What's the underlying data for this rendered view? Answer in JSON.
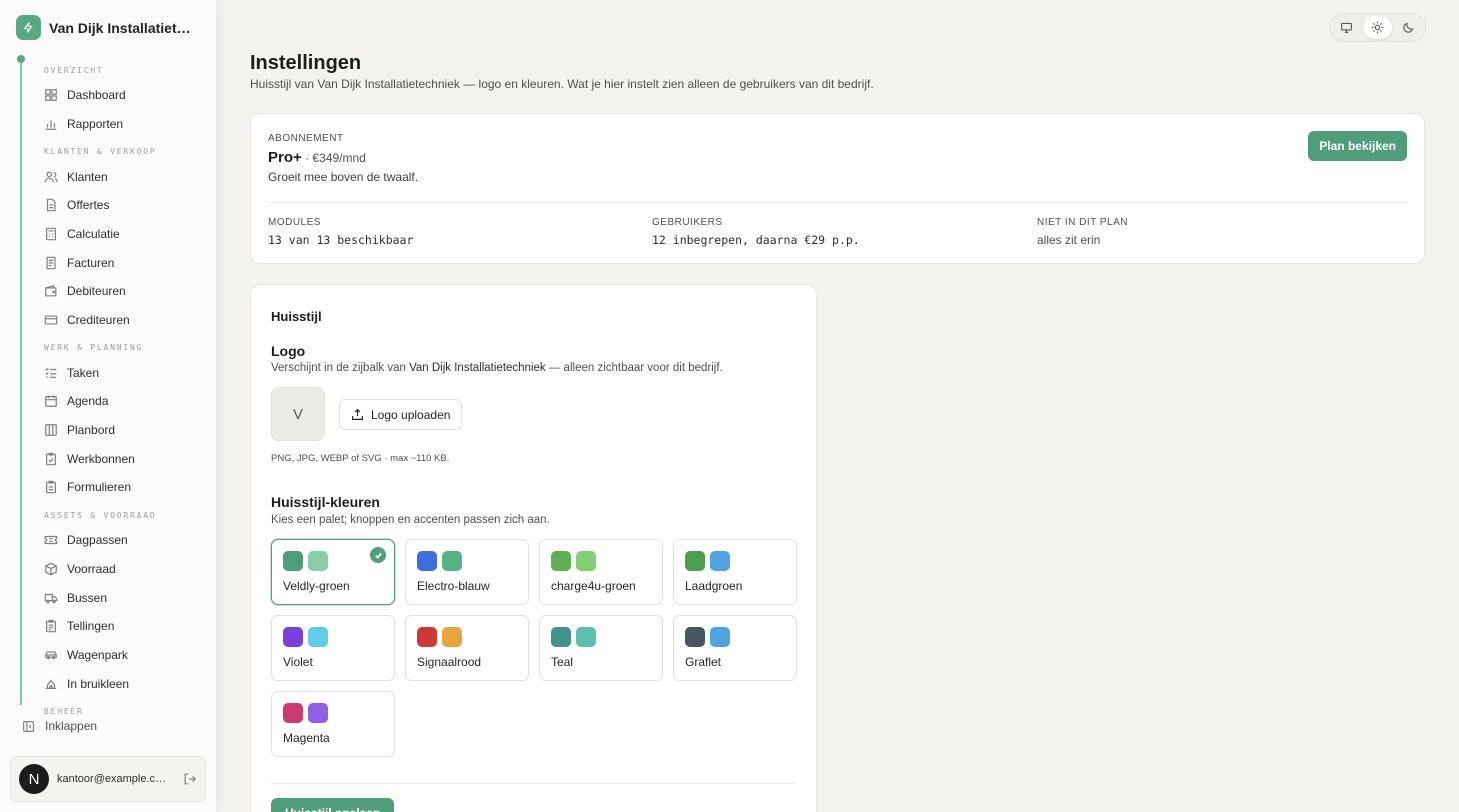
{
  "sidebar": {
    "company": "Van Dijk Installatietechniek",
    "sections": {
      "overzicht": "OVERZICHT",
      "klanten": "KLANTEN & VERKOOP",
      "werk": "WERK & PLANNING",
      "assets": "ASSETS & VOORRAAD",
      "beheer": "BEHEER"
    },
    "items": {
      "dashboard": "Dashboard",
      "rapporten": "Rapporten",
      "klanten": "Klanten",
      "offertes": "Offertes",
      "calculatie": "Calculatie",
      "facturen": "Facturen",
      "debiteuren": "Debiteuren",
      "crediteuren": "Crediteuren",
      "taken": "Taken",
      "agenda": "Agenda",
      "planbord": "Planbord",
      "werkbonnen": "Werkbonnen",
      "formulieren": "Formulieren",
      "dagpassen": "Dagpassen",
      "voorraad": "Voorraad",
      "bussen": "Bussen",
      "tellingen": "Tellingen",
      "wagenpark": "Wagenpark",
      "inbruikleen": "In bruikleen"
    },
    "collapse_label": "Inklappen",
    "user": {
      "initial": "N",
      "email": "kantoor@example.com"
    }
  },
  "header": {
    "title": "Instellingen",
    "subtitle": "Huisstijl van Van Dijk Installatietechniek — logo en kleuren. Wat je hier instelt zien alleen de gebruikers van dit bedrijf."
  },
  "plan": {
    "label": "ABONNEMENT",
    "name": "Pro+",
    "price": " · €349/mnd",
    "description": "Groeit mee boven de twaalf.",
    "button": "Plan bekijken",
    "stats": {
      "modules_label": "MODULES",
      "modules_value": "13 van 13 beschikbaar",
      "users_label": "GEBRUIKERS",
      "users_value": "12 inbegrepen, daarna €29 p.p.",
      "missing_label": "NIET IN DIT PLAN",
      "missing_value": "alles zit erin"
    }
  },
  "huisstijl": {
    "title": "Huisstijl",
    "logo_title": "Logo",
    "logo_desc_pre": "Verschijnt in de zijbalk van ",
    "logo_desc_company": "Van Dijk Installatietechniek",
    "logo_desc_post": " — alleen zichtbaar voor dit bedrijf.",
    "logo_placeholder": "V",
    "upload_button": "Logo uploaden",
    "logo_hint": "PNG, JPG, WEBP of SVG · max ~110 KB.",
    "colors_title": "Huisstijl-kleuren",
    "colors_desc": "Kies een palet; knoppen en accenten passen zich aan.",
    "save_button": "Huisstijl opslaan",
    "selected": "Veldly-groen",
    "palettes": [
      {
        "name": "Veldly-groen",
        "primary": "#4f9e79",
        "secondary": "#86cfa8"
      },
      {
        "name": "Electro-blauw",
        "primary": "#3b6fe0",
        "secondary": "#54b583"
      },
      {
        "name": "charge4u-groen",
        "primary": "#5fae4f",
        "secondary": "#82d072"
      },
      {
        "name": "Laadgroen",
        "primary": "#4b9f4f",
        "secondary": "#4fa3e0"
      },
      {
        "name": "Violet",
        "primary": "#7b3fe0",
        "secondary": "#5fcde8"
      },
      {
        "name": "Signaalrood",
        "primary": "#cc3a35",
        "secondary": "#e8a33a"
      },
      {
        "name": "Teal",
        "primary": "#3f9488",
        "secondary": "#5bbfae"
      },
      {
        "name": "Graflet",
        "primary": "#4a5563",
        "secondary": "#4fa3e0"
      },
      {
        "name": "Magenta",
        "primary": "#cc3a72",
        "secondary": "#8f5fe8"
      }
    ]
  },
  "theme": {
    "options": [
      "monitor-icon",
      "sun-icon",
      "moon-icon"
    ],
    "active": "sun-icon"
  }
}
